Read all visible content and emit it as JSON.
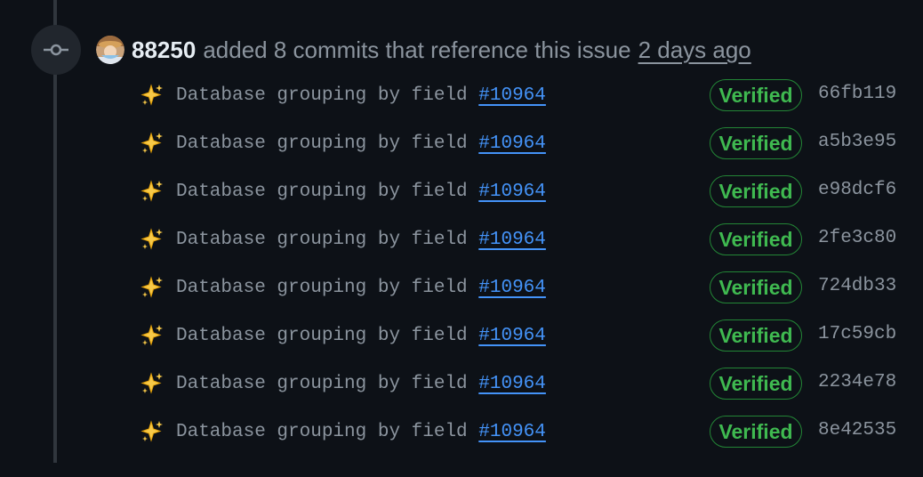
{
  "event": {
    "icon": "git-commit-icon",
    "author": "88250",
    "action_text": "added 8 commits that reference this issue",
    "time_ago": "2 days ago"
  },
  "commits": [
    {
      "icon": "sparkles-icon",
      "message": "Database grouping by field",
      "issue_ref": "#10964",
      "verified_label": "Verified",
      "sha": "66fb119"
    },
    {
      "icon": "sparkles-icon",
      "message": "Database grouping by field",
      "issue_ref": "#10964",
      "verified_label": "Verified",
      "sha": "a5b3e95"
    },
    {
      "icon": "sparkles-icon",
      "message": "Database grouping by field",
      "issue_ref": "#10964",
      "verified_label": "Verified",
      "sha": "e98dcf6"
    },
    {
      "icon": "sparkles-icon",
      "message": "Database grouping by field",
      "issue_ref": "#10964",
      "verified_label": "Verified",
      "sha": "2fe3c80"
    },
    {
      "icon": "sparkles-icon",
      "message": "Database grouping by field",
      "issue_ref": "#10964",
      "verified_label": "Verified",
      "sha": "724db33"
    },
    {
      "icon": "sparkles-icon",
      "message": "Database grouping by field",
      "issue_ref": "#10964",
      "verified_label": "Verified",
      "sha": "17c59cb"
    },
    {
      "icon": "sparkles-icon",
      "message": "Database grouping by field",
      "issue_ref": "#10964",
      "verified_label": "Verified",
      "sha": "2234e78"
    },
    {
      "icon": "sparkles-icon",
      "message": "Database grouping by field",
      "issue_ref": "#10964",
      "verified_label": "Verified",
      "sha": "8e42535"
    }
  ],
  "colors": {
    "background": "#0d1117",
    "muted_text": "#8b949e",
    "link_blue": "#4493f8",
    "verified_green": "#3fb950",
    "verified_border": "#238636"
  }
}
